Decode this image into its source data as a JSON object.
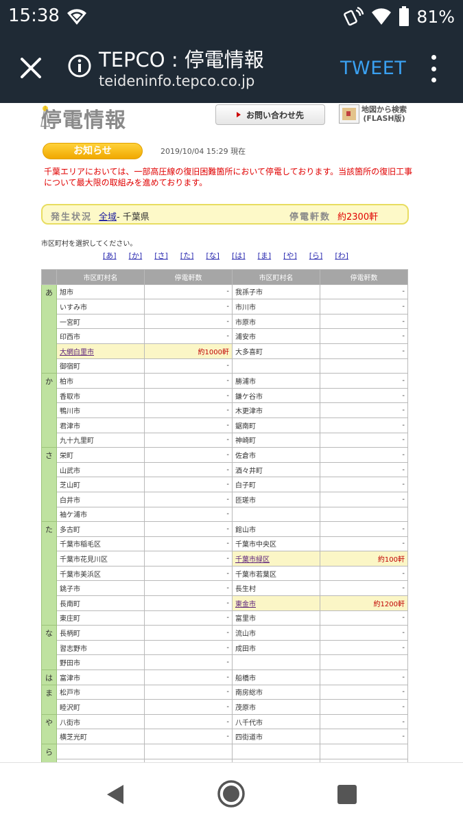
{
  "status_bar": {
    "time": "15:38",
    "battery": "81%"
  },
  "app_bar": {
    "title": "TEPCO : 停電情報",
    "url": "teideninfo.tepco.co.jp",
    "tweet": "TWEET"
  },
  "page": {
    "logo": "停電情報",
    "contact_button": "お問い合わせ先",
    "map_search": "地図から検索",
    "map_search_sub": "(FLASH版)",
    "notice_label": "お知らせ",
    "timestamp": "2019/10/04 15:29 現在",
    "notice": "千葉エリアにおいては、一部高圧線の復旧困難箇所において停電しております。当該箇所の復旧工事について最大限の取組みを進めております。",
    "status_label": "発生状況",
    "status_link": "全域",
    "status_pref": "- 千葉県",
    "outage_label": "停電軒数",
    "outage_count": "約2300軒",
    "select_prompt": "市区町村を選択してください。",
    "kana_links": [
      "[あ]",
      "[か]",
      "[さ]",
      "[た]",
      "[な]",
      "[は]",
      "[ま]",
      "[や]",
      "[ら]",
      "[わ]"
    ]
  },
  "table": {
    "headers": [
      "市区町村名",
      "停電軒数",
      "市区町村名",
      "停電軒数"
    ]
  }
}
